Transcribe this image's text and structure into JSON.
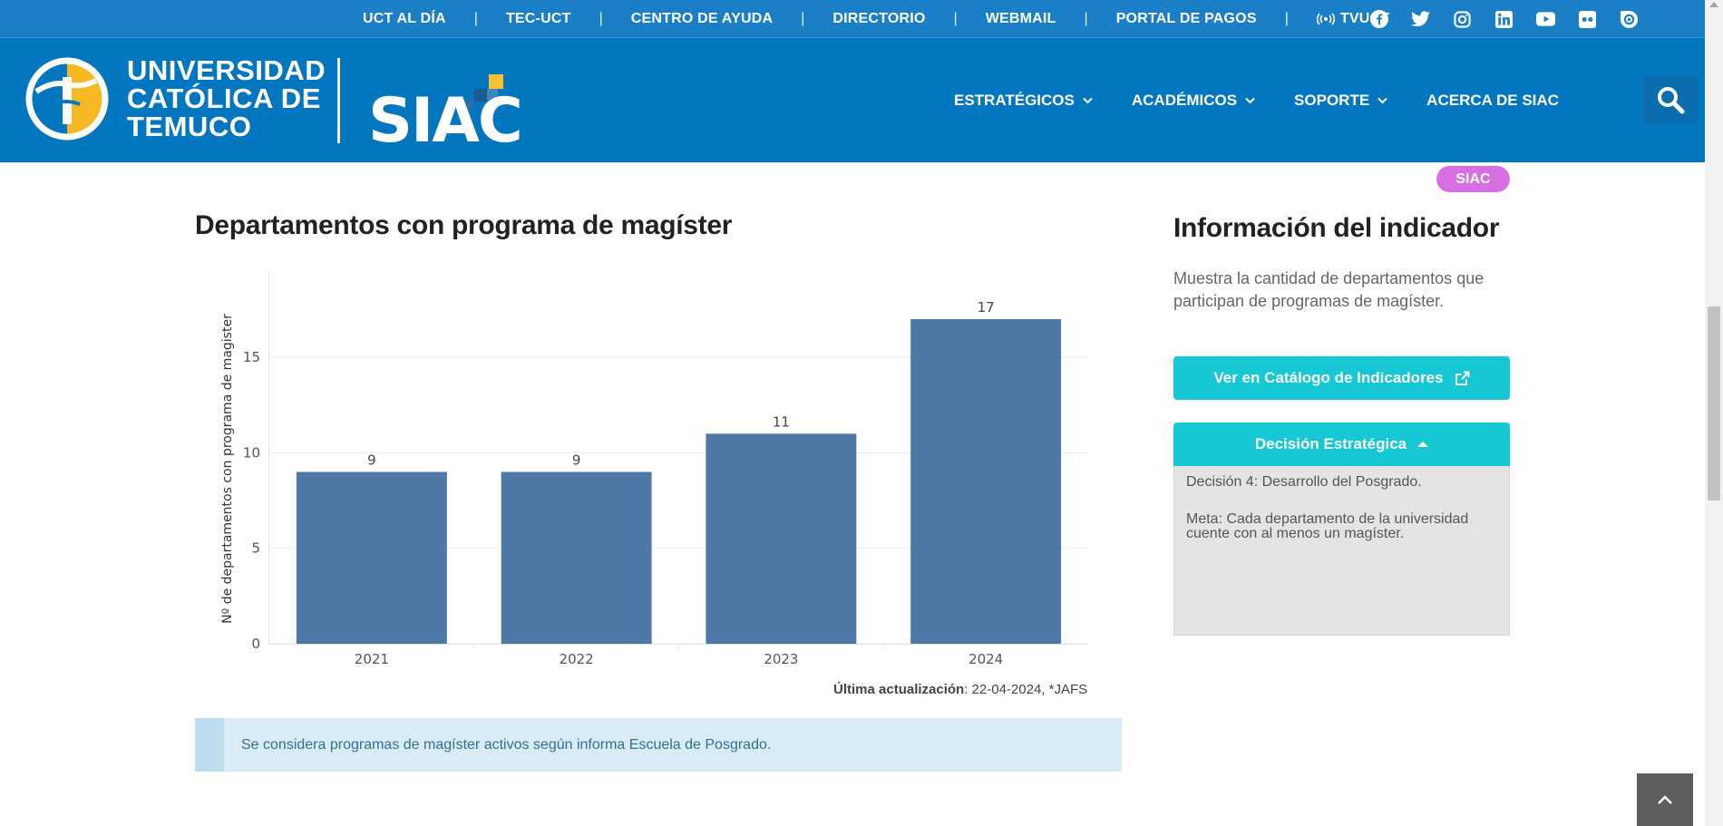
{
  "topbar": {
    "links": [
      "UCT AL DÍA",
      "TEC-UCT",
      "CENTRO DE AYUDA",
      "DIRECTORIO",
      "WEBMAIL",
      "PORTAL DE PAGOS"
    ],
    "separator": "|",
    "tvuct": "TVUCT",
    "social_icons": [
      "facebook-icon",
      "twitter-icon",
      "instagram-icon",
      "linkedin-icon",
      "youtube-icon",
      "flickr-icon",
      "issuu-icon"
    ]
  },
  "header": {
    "uct_line1": "UNIVERSIDAD",
    "uct_line2": "CATÓLICA DE",
    "uct_line3": "TEMUCO",
    "siac_logo": "SIAC",
    "nav": [
      {
        "label": "ESTRATÉGICOS",
        "dropdown": true
      },
      {
        "label": "ACADÉMICOS",
        "dropdown": true
      },
      {
        "label": "SOPORTE",
        "dropdown": true
      },
      {
        "label": "ACERCA DE SIAC",
        "dropdown": false
      }
    ]
  },
  "badge": "SIAC",
  "main": {
    "title": "Departamentos con programa de magíster",
    "updated_label": "Última actualización",
    "updated_value": ": 22-04-2024, *JAFS",
    "note": "Se considera programas de magíster activos según informa Escuela de Posgrado."
  },
  "chart_data": {
    "type": "bar",
    "categories": [
      "2021",
      "2022",
      "2023",
      "2024"
    ],
    "values": [
      9,
      9,
      11,
      17
    ],
    "title": "",
    "xlabel": "",
    "ylabel": "Nº de departamentos con programa de magister",
    "ylim": [
      0,
      18.9
    ],
    "yticks": [
      0,
      5,
      10,
      15
    ],
    "data_labels": true,
    "grid": true,
    "legend": "none"
  },
  "sidebar": {
    "title": "Información del indicador",
    "description": "Muestra la cantidad de departamentos que participan de programas de magíster.",
    "catalog_button": "Ver en Catálogo de Indicadores",
    "accordion_title": "Decisión Estratégica",
    "decision": "Decisión 4: Desarrollo del Posgrado.",
    "goal": "Meta: Cada departamento de la universidad cuente con al menos un magíster."
  },
  "colors": {
    "topbar": "#1a7fc6",
    "header": "#0276bf",
    "bar": "#4e79a7",
    "accent": "#16c8d4",
    "badge": "#d76ee2",
    "note_bg": "#d9ecf6",
    "note_text": "#31708f"
  }
}
